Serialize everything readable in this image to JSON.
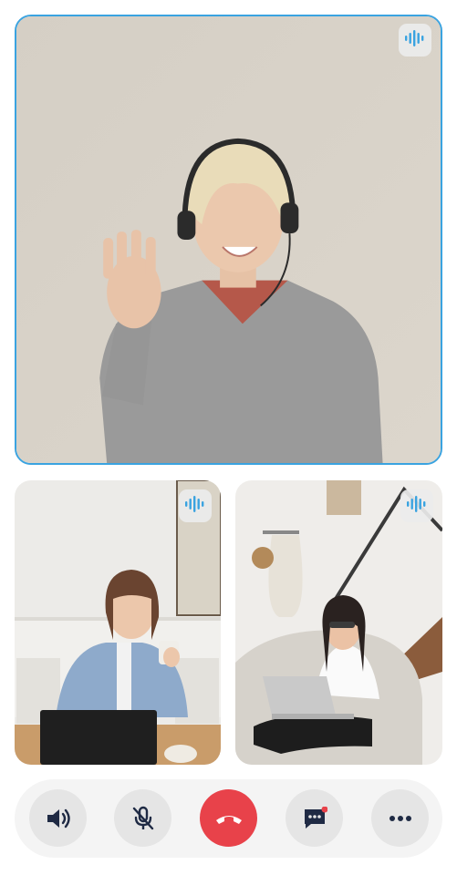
{
  "participants": [
    {
      "role": "main",
      "speaking_icon": "audio-wave-icon"
    },
    {
      "role": "left",
      "speaking_icon": "audio-wave-icon"
    },
    {
      "role": "right",
      "speaking_icon": "audio-wave-icon"
    }
  ],
  "controls": [
    {
      "icon": "speaker-icon"
    },
    {
      "icon": "mic-muted-icon"
    },
    {
      "icon": "end-call-icon"
    },
    {
      "icon": "chat-icon",
      "has_notification": true
    },
    {
      "icon": "more-icon"
    }
  ],
  "colors": {
    "accent": "#3aa3e0",
    "end_call": "#e8424a",
    "notification": "#e8424a",
    "control_bg": "#e5e5e5",
    "bar_bg": "#f4f4f4",
    "icon": "#1f2a44"
  }
}
